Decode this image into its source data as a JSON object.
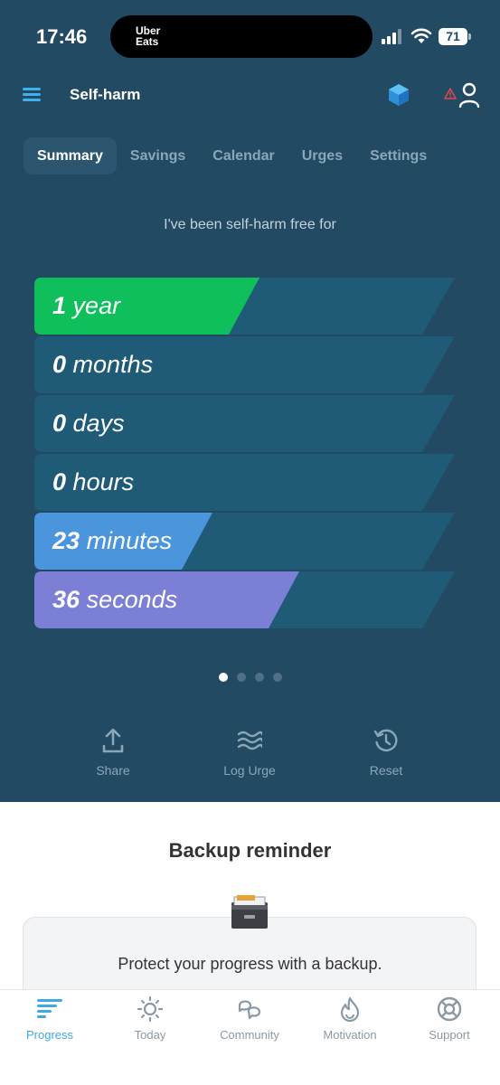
{
  "status_bar": {
    "time": "17:46",
    "island_label": "Uber\nEats",
    "battery": "71"
  },
  "header": {
    "title": "Self-harm"
  },
  "tabs": [
    {
      "label": "Summary",
      "active": true
    },
    {
      "label": "Savings",
      "active": false
    },
    {
      "label": "Calendar",
      "active": false
    },
    {
      "label": "Urges",
      "active": false
    },
    {
      "label": "Settings",
      "active": false
    }
  ],
  "summary": {
    "intro": "I've been self-harm free for",
    "counters": [
      {
        "value": "1",
        "unit": "year",
        "color": "#0fbf5b",
        "fill": 1.0
      },
      {
        "value": "0",
        "unit": "months",
        "color": "#1d6b8a",
        "fill": 0.0
      },
      {
        "value": "0",
        "unit": "days",
        "color": "#1d6b8a",
        "fill": 0.0
      },
      {
        "value": "0",
        "unit": "hours",
        "color": "#1d6b8a",
        "fill": 0.0
      },
      {
        "value": "23",
        "unit": "minutes",
        "color": "#4a95dc",
        "fill": 0.38
      },
      {
        "value": "36",
        "unit": "seconds",
        "color": "#7b80d6",
        "fill": 0.6
      }
    ],
    "page_dots": {
      "count": 4,
      "active_index": 0
    }
  },
  "actions": [
    {
      "label": "Share",
      "icon": "share-icon"
    },
    {
      "label": "Log Urge",
      "icon": "waves-icon"
    },
    {
      "label": "Reset",
      "icon": "history-icon"
    }
  ],
  "backup": {
    "title": "Backup reminder",
    "message": "Protect your progress with a backup."
  },
  "bottom_nav": [
    {
      "label": "Progress",
      "icon": "progress-icon",
      "active": true
    },
    {
      "label": "Today",
      "icon": "sun-icon",
      "active": false
    },
    {
      "label": "Community",
      "icon": "community-icon",
      "active": false
    },
    {
      "label": "Motivation",
      "icon": "flame-icon",
      "active": false
    },
    {
      "label": "Support",
      "icon": "lifebuoy-icon",
      "active": false
    }
  ],
  "colors": {
    "background": "#224a63",
    "accent": "#3ea9e6",
    "year_bar": "#0fbf5b",
    "minutes_bar": "#4a95dc",
    "seconds_bar": "#7b80d6"
  }
}
